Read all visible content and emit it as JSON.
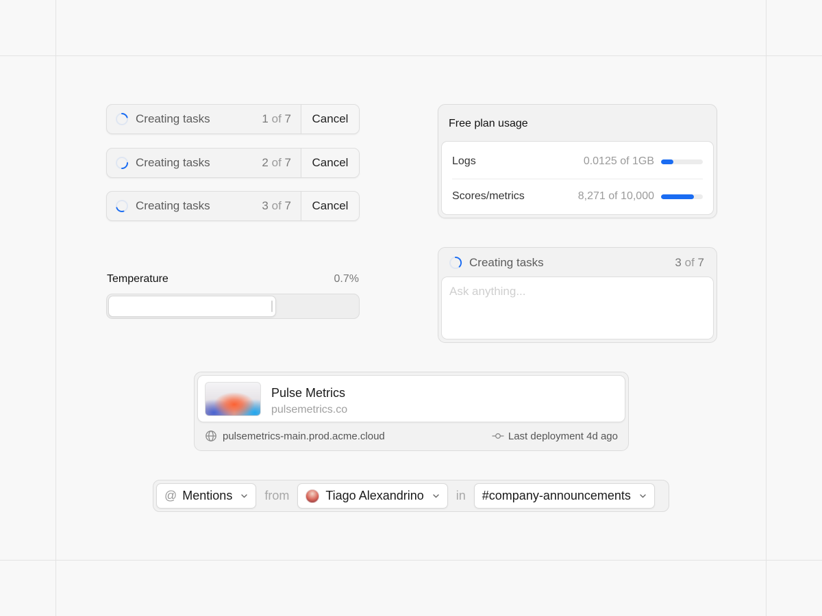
{
  "tasks": [
    {
      "label": "Creating tasks",
      "current": "1",
      "of": "of",
      "total": "7",
      "cancel": "Cancel"
    },
    {
      "label": "Creating tasks",
      "current": "2",
      "of": "of",
      "total": "7",
      "cancel": "Cancel"
    },
    {
      "label": "Creating tasks",
      "current": "3",
      "of": "of",
      "total": "7",
      "cancel": "Cancel"
    }
  ],
  "temperature": {
    "label": "Temperature",
    "value": "0.7%",
    "fill_fraction": 0.67
  },
  "usage": {
    "title": "Free plan usage",
    "rows": [
      {
        "name": "Logs",
        "amount": "0.0125 of 1GB",
        "fill_fraction": 0.3
      },
      {
        "name": "Scores/metrics",
        "amount": "8,271 of 10,000",
        "fill_fraction": 0.78
      }
    ],
    "accent_color": "#1a6cf2"
  },
  "composer": {
    "status": "Creating tasks",
    "current": "3",
    "of": "of",
    "total": "7",
    "placeholder": "Ask anything..."
  },
  "project": {
    "name": "Pulse Metrics",
    "domain": "pulsemetrics.co",
    "url": "pulsemetrics-main.prod.acme.cloud",
    "deployment": "Last deployment 4d ago"
  },
  "filter": {
    "type_label": "Mentions",
    "from_word": "from",
    "user": "Tiago Alexandrino",
    "in_word": "in",
    "channel": "#company-announcements"
  }
}
